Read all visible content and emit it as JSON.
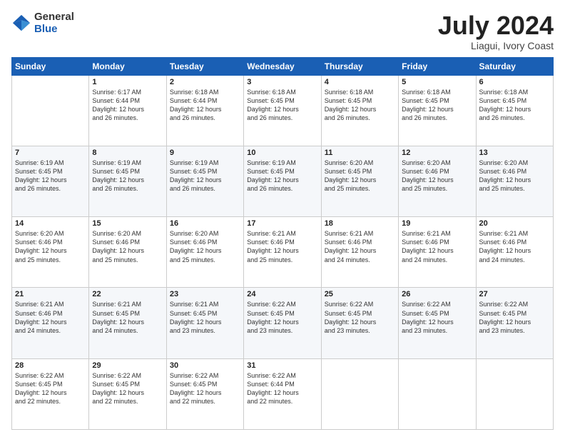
{
  "logo": {
    "general": "General",
    "blue": "Blue"
  },
  "title": {
    "month": "July 2024",
    "location": "Liagui, Ivory Coast"
  },
  "days_header": [
    "Sunday",
    "Monday",
    "Tuesday",
    "Wednesday",
    "Thursday",
    "Friday",
    "Saturday"
  ],
  "weeks": [
    [
      {
        "day": "",
        "info": ""
      },
      {
        "day": "1",
        "info": "Sunrise: 6:17 AM\nSunset: 6:44 PM\nDaylight: 12 hours\nand 26 minutes."
      },
      {
        "day": "2",
        "info": "Sunrise: 6:18 AM\nSunset: 6:44 PM\nDaylight: 12 hours\nand 26 minutes."
      },
      {
        "day": "3",
        "info": "Sunrise: 6:18 AM\nSunset: 6:45 PM\nDaylight: 12 hours\nand 26 minutes."
      },
      {
        "day": "4",
        "info": "Sunrise: 6:18 AM\nSunset: 6:45 PM\nDaylight: 12 hours\nand 26 minutes."
      },
      {
        "day": "5",
        "info": "Sunrise: 6:18 AM\nSunset: 6:45 PM\nDaylight: 12 hours\nand 26 minutes."
      },
      {
        "day": "6",
        "info": "Sunrise: 6:18 AM\nSunset: 6:45 PM\nDaylight: 12 hours\nand 26 minutes."
      }
    ],
    [
      {
        "day": "7",
        "info": "Sunrise: 6:19 AM\nSunset: 6:45 PM\nDaylight: 12 hours\nand 26 minutes."
      },
      {
        "day": "8",
        "info": "Sunrise: 6:19 AM\nSunset: 6:45 PM\nDaylight: 12 hours\nand 26 minutes."
      },
      {
        "day": "9",
        "info": "Sunrise: 6:19 AM\nSunset: 6:45 PM\nDaylight: 12 hours\nand 26 minutes."
      },
      {
        "day": "10",
        "info": "Sunrise: 6:19 AM\nSunset: 6:45 PM\nDaylight: 12 hours\nand 26 minutes."
      },
      {
        "day": "11",
        "info": "Sunrise: 6:20 AM\nSunset: 6:45 PM\nDaylight: 12 hours\nand 25 minutes."
      },
      {
        "day": "12",
        "info": "Sunrise: 6:20 AM\nSunset: 6:46 PM\nDaylight: 12 hours\nand 25 minutes."
      },
      {
        "day": "13",
        "info": "Sunrise: 6:20 AM\nSunset: 6:46 PM\nDaylight: 12 hours\nand 25 minutes."
      }
    ],
    [
      {
        "day": "14",
        "info": "Sunrise: 6:20 AM\nSunset: 6:46 PM\nDaylight: 12 hours\nand 25 minutes."
      },
      {
        "day": "15",
        "info": "Sunrise: 6:20 AM\nSunset: 6:46 PM\nDaylight: 12 hours\nand 25 minutes."
      },
      {
        "day": "16",
        "info": "Sunrise: 6:20 AM\nSunset: 6:46 PM\nDaylight: 12 hours\nand 25 minutes."
      },
      {
        "day": "17",
        "info": "Sunrise: 6:21 AM\nSunset: 6:46 PM\nDaylight: 12 hours\nand 25 minutes."
      },
      {
        "day": "18",
        "info": "Sunrise: 6:21 AM\nSunset: 6:46 PM\nDaylight: 12 hours\nand 24 minutes."
      },
      {
        "day": "19",
        "info": "Sunrise: 6:21 AM\nSunset: 6:46 PM\nDaylight: 12 hours\nand 24 minutes."
      },
      {
        "day": "20",
        "info": "Sunrise: 6:21 AM\nSunset: 6:46 PM\nDaylight: 12 hours\nand 24 minutes."
      }
    ],
    [
      {
        "day": "21",
        "info": "Sunrise: 6:21 AM\nSunset: 6:46 PM\nDaylight: 12 hours\nand 24 minutes."
      },
      {
        "day": "22",
        "info": "Sunrise: 6:21 AM\nSunset: 6:45 PM\nDaylight: 12 hours\nand 24 minutes."
      },
      {
        "day": "23",
        "info": "Sunrise: 6:21 AM\nSunset: 6:45 PM\nDaylight: 12 hours\nand 23 minutes."
      },
      {
        "day": "24",
        "info": "Sunrise: 6:22 AM\nSunset: 6:45 PM\nDaylight: 12 hours\nand 23 minutes."
      },
      {
        "day": "25",
        "info": "Sunrise: 6:22 AM\nSunset: 6:45 PM\nDaylight: 12 hours\nand 23 minutes."
      },
      {
        "day": "26",
        "info": "Sunrise: 6:22 AM\nSunset: 6:45 PM\nDaylight: 12 hours\nand 23 minutes."
      },
      {
        "day": "27",
        "info": "Sunrise: 6:22 AM\nSunset: 6:45 PM\nDaylight: 12 hours\nand 23 minutes."
      }
    ],
    [
      {
        "day": "28",
        "info": "Sunrise: 6:22 AM\nSunset: 6:45 PM\nDaylight: 12 hours\nand 22 minutes."
      },
      {
        "day": "29",
        "info": "Sunrise: 6:22 AM\nSunset: 6:45 PM\nDaylight: 12 hours\nand 22 minutes."
      },
      {
        "day": "30",
        "info": "Sunrise: 6:22 AM\nSunset: 6:45 PM\nDaylight: 12 hours\nand 22 minutes."
      },
      {
        "day": "31",
        "info": "Sunrise: 6:22 AM\nSunset: 6:44 PM\nDaylight: 12 hours\nand 22 minutes."
      },
      {
        "day": "",
        "info": ""
      },
      {
        "day": "",
        "info": ""
      },
      {
        "day": "",
        "info": ""
      }
    ]
  ]
}
